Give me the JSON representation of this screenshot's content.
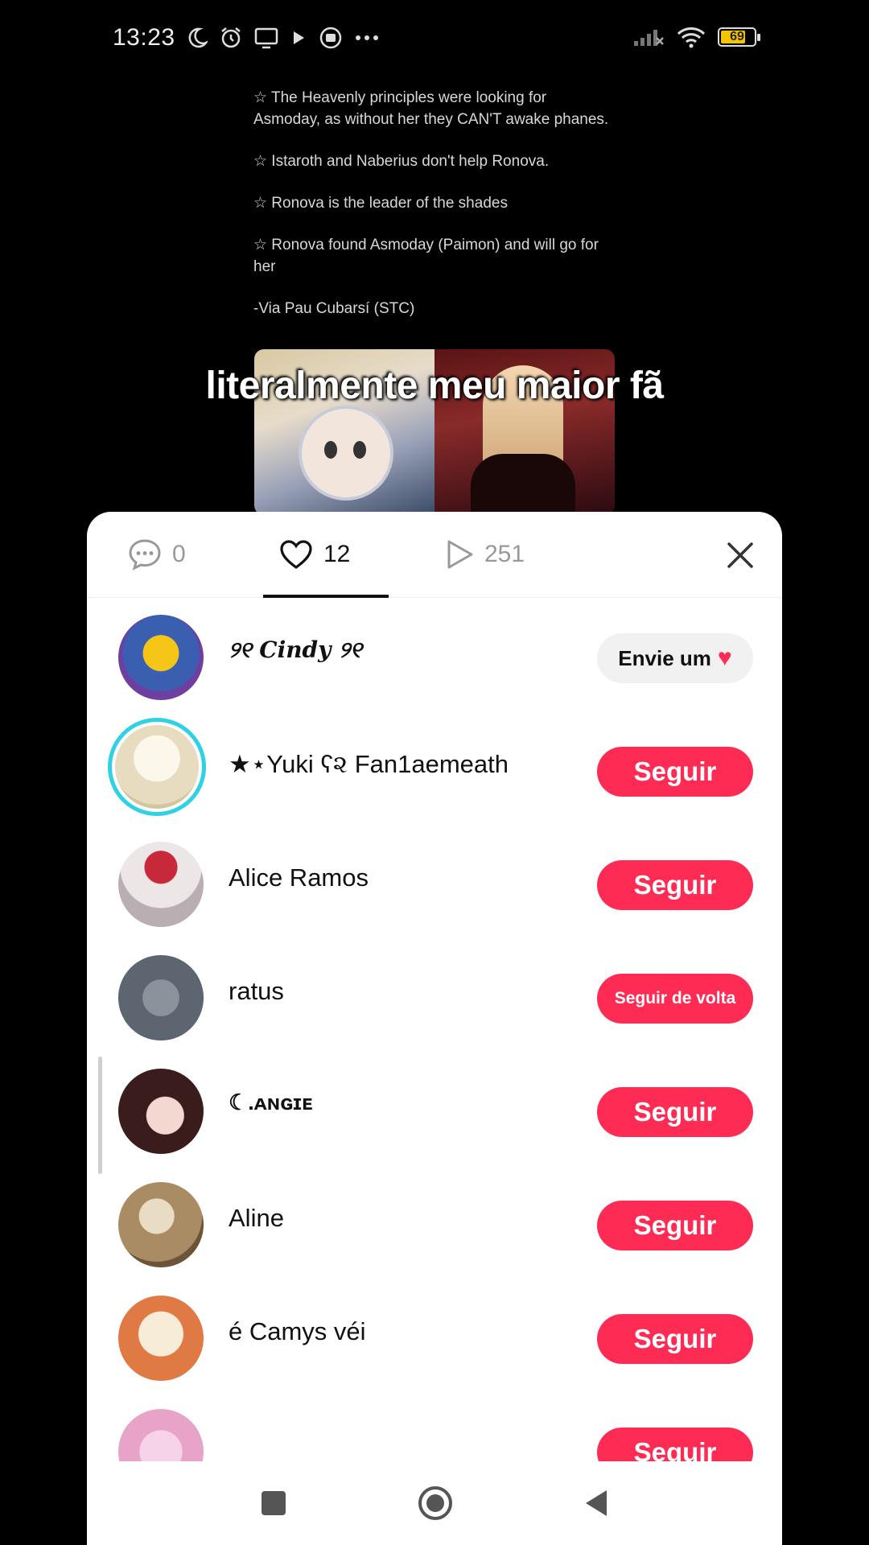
{
  "status_bar": {
    "time": "13:23",
    "battery": "69"
  },
  "tweet": {
    "lines": [
      "☆ The Heavenly principles were looking for Asmoday, as without her they CAN'T awake phanes.",
      "☆ Istaroth and Naberius don't help Ronova.",
      "☆ Ronova is the leader of the shades",
      "☆ Ronova found Asmoday (Paimon) and will go for her",
      "-Via Pau Cubarsí (STC)"
    ]
  },
  "caption": "literalmente meu maior fã",
  "sheet": {
    "tabs": [
      {
        "icon": "comment-icon",
        "count": "0"
      },
      {
        "icon": "heart-icon",
        "count": "12"
      },
      {
        "icon": "play-icon",
        "count": "251"
      }
    ],
    "users": [
      {
        "name": "୨୧ 𝑪𝒊𝒏𝒅𝒚 ୨୧",
        "action": "Envie um",
        "avatar_color": "#3a5fb0"
      },
      {
        "name": "★⋆Yuki ʕ૨ Fan1aemeath",
        "action": "Seguir",
        "avatar_color": "#efe8d6"
      },
      {
        "name": "Alice Ramos",
        "action": "Seguir",
        "avatar_color": "#d7d0d2"
      },
      {
        "name": "ratus",
        "action": "Seguir de volta",
        "avatar_color": "#5d6670"
      },
      {
        "name": "☾.ᴀɴɢɪᴇ",
        "action": "Seguir",
        "avatar_color": "#3b1c1c"
      },
      {
        "name": "Aline",
        "action": "Seguir",
        "avatar_color": "#a98c64"
      },
      {
        "name": "é Camys véi",
        "action": "Seguir",
        "avatar_color": "#e07a45"
      },
      {
        "name": "",
        "action": "Seguir",
        "avatar_color": "#e7a3c8"
      }
    ]
  }
}
